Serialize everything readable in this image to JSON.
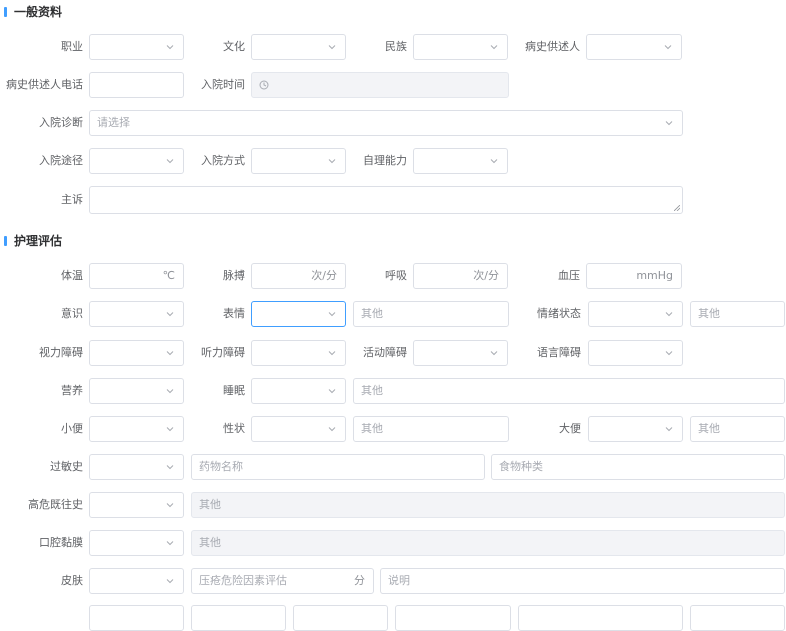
{
  "sections": {
    "general": "一般资料",
    "nursing": "护理评估"
  },
  "fields": {
    "occupation": "职业",
    "education": "文化",
    "ethnicity": "民族",
    "historian": "病史供述人",
    "historian_phone": "病史供述人电话",
    "admit_time": "入院时间",
    "admit_diagnosis": "入院诊断",
    "admit_diagnosis_placeholder": "请选择",
    "admit_route": "入院途径",
    "admit_mode": "入院方式",
    "self_care": "自理能力",
    "chief_complaint": "主诉",
    "temperature": "体温",
    "temperature_unit": "℃",
    "pulse": "脉搏",
    "pulse_unit": "次/分",
    "respiration": "呼吸",
    "respiration_unit": "次/分",
    "blood_pressure": "血压",
    "bp_unit": "mmHg",
    "consciousness": "意识",
    "expression": "表情",
    "other_placeholder": "其他",
    "mood": "情绪状态",
    "vision": "视力障碍",
    "hearing": "听力障碍",
    "mobility": "活动障碍",
    "speech": "语言障碍",
    "nutrition": "营养",
    "sleep": "睡眠",
    "urine": "小便",
    "character": "性状",
    "stool": "大便",
    "allergy": "过敏史",
    "drug_name_placeholder": "药物名称",
    "food_type_placeholder": "食物种类",
    "high_risk_history": "高危既往史",
    "oral_mucosa": "口腔黏膜",
    "skin": "皮肤",
    "pressure_risk_placeholder": "压疮危险因素评估",
    "score_unit": "分",
    "note_placeholder": "说明"
  },
  "colors": {
    "accent": "#409eff",
    "border": "#dcdfe6",
    "disabled_bg": "#f3f4f7"
  }
}
